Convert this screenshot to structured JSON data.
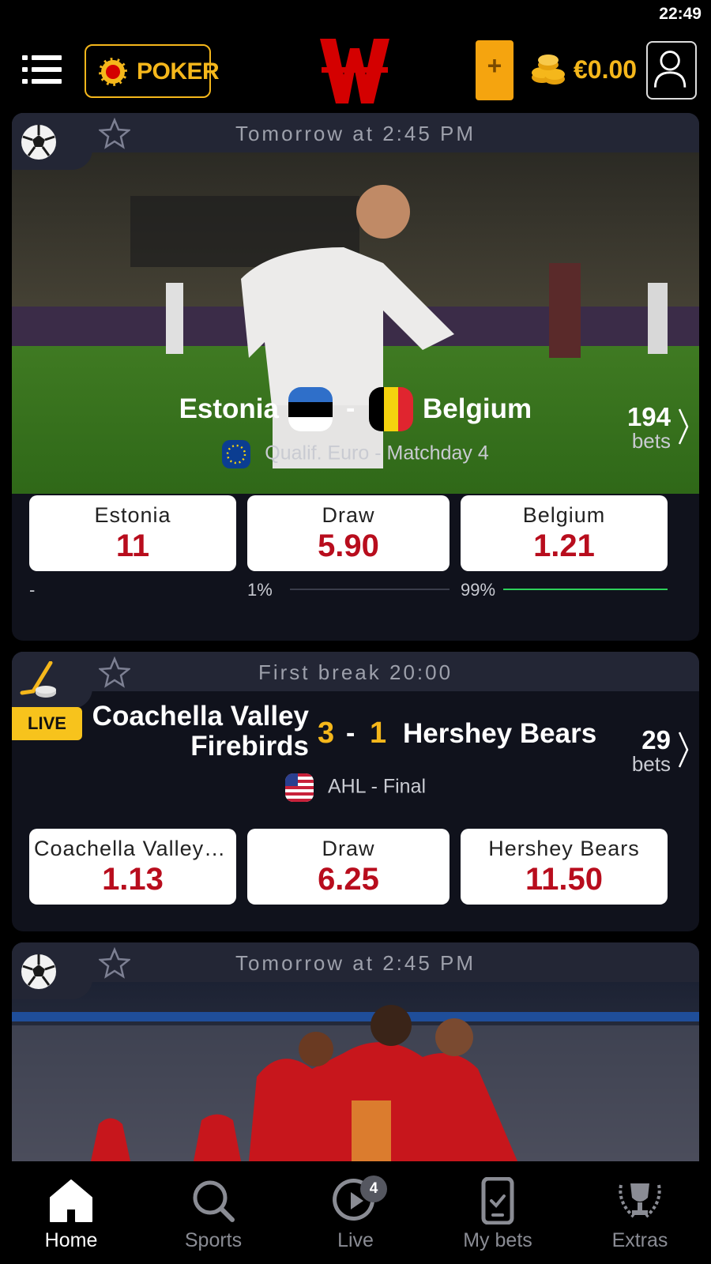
{
  "status_bar": {
    "time": "22:49"
  },
  "header": {
    "menu_icon": "menu-icon",
    "poker_label": "POKER",
    "logo_icon": "winamax-logo",
    "deposit_label": "+",
    "balance": "€0.00",
    "profile_icon": "user-icon"
  },
  "matches": [
    {
      "sport_icon": "soccer-ball-icon",
      "time": "Tomorrow at 2:45 PM",
      "home": "Estonia",
      "away": "Belgium",
      "competition": "Qualif. Euro - Matchday 4",
      "bets_count": "194",
      "bets_label": "bets",
      "odds": [
        {
          "label": "Estonia",
          "value": "11"
        },
        {
          "label": "Draw",
          "value": "5.90"
        },
        {
          "label": "Belgium",
          "value": "1.21"
        }
      ],
      "distribution": [
        {
          "label": "-",
          "share": 0
        },
        {
          "label": "1%",
          "share": 0.01
        },
        {
          "label": "99%",
          "share": 0.99
        }
      ],
      "colors": {
        "favorite_line": "#2ed15a",
        "other_line": "#3a3d4a"
      }
    },
    {
      "sport_icon": "hockey-stick-icon",
      "time": "First break 20:00",
      "live_label": "LIVE",
      "home": "Coachella Valley Firebirds",
      "home_line1": "Coachella Valley",
      "home_line2": "Firebirds",
      "away": "Hershey Bears",
      "home_score": "3",
      "away_score": "1",
      "competition": "AHL - Final",
      "bets_count": "29",
      "bets_label": "bets",
      "odds": [
        {
          "label": "Coachella Valley F...",
          "value": "1.13"
        },
        {
          "label": "Draw",
          "value": "6.25"
        },
        {
          "label": "Hershey Bears",
          "value": "11.50"
        }
      ]
    },
    {
      "sport_icon": "soccer-ball-icon",
      "time": "Tomorrow at 2:45 PM"
    }
  ],
  "nav": [
    {
      "label": "Home",
      "icon": "home-icon",
      "active": true
    },
    {
      "label": "Sports",
      "icon": "search-icon",
      "active": false
    },
    {
      "label": "Live",
      "icon": "play-icon",
      "badge": "4",
      "active": false
    },
    {
      "label": "My bets",
      "icon": "phone-ticket-icon",
      "active": false
    },
    {
      "label": "Extras",
      "icon": "trophy-icon",
      "active": false
    }
  ],
  "colors": {
    "brand_yellow": "#f5b71b",
    "brand_red": "#d40000",
    "odds_red": "#b80d1d",
    "card_bg": "#10121c",
    "card_header": "#232635"
  }
}
